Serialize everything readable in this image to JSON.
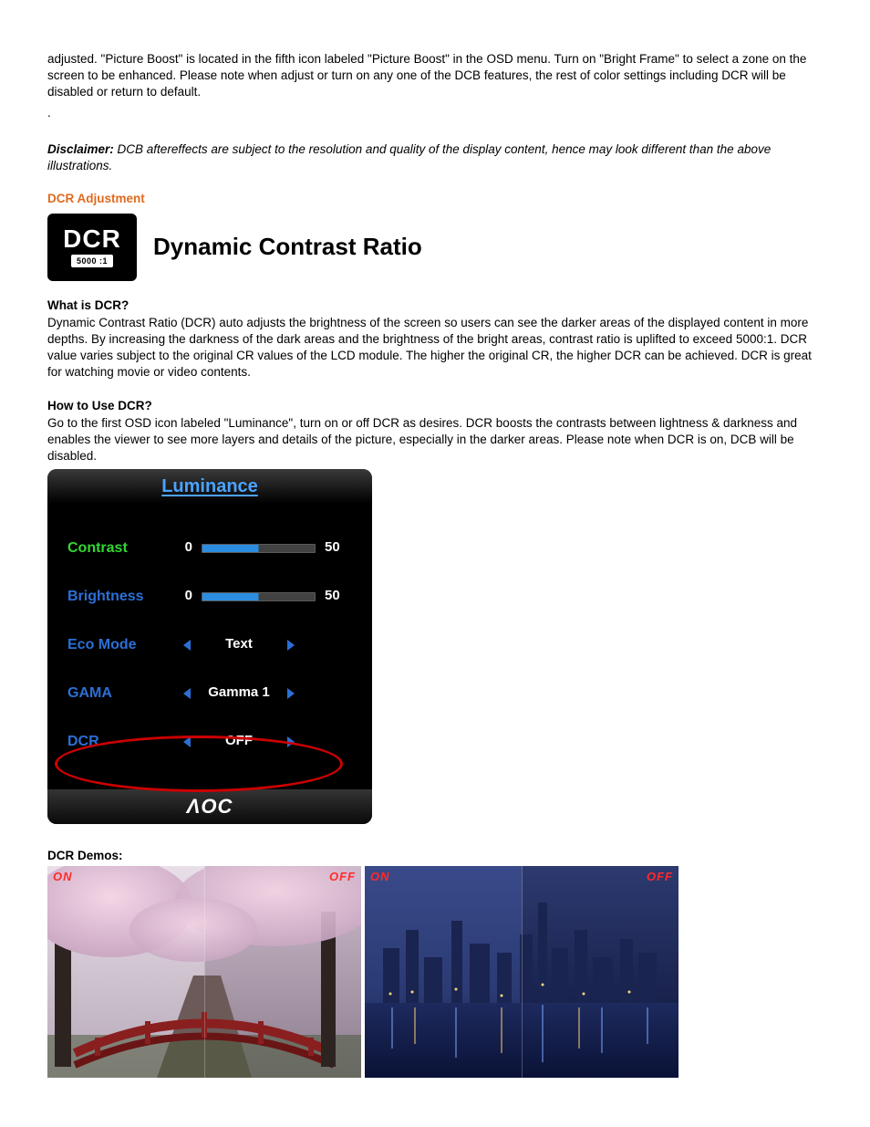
{
  "intro": {
    "paragraph": "adjusted. \"Picture Boost\" is located in the fifth icon labeled \"Picture Boost\" in the OSD menu. Turn on \"Bright Frame\" to select a zone on the screen to be enhanced. Please note when adjust or turn on any one of the DCB features, the rest of color settings including DCR will be disabled or return to default.",
    "dot": "."
  },
  "disclaimer": {
    "label": "Disclaimer:",
    "text": " DCB aftereffects are subject to the resolution and quality of the display content, hence may look different than the above illustrations."
  },
  "dcr": {
    "heading": "DCR Adjustment",
    "icon_text": "DCR",
    "icon_ratio": "5000 :1",
    "title": "Dynamic Contrast Ratio",
    "what_heading": "What is DCR?",
    "what_text": "Dynamic Contrast Ratio (DCR) auto adjusts the brightness of the screen so users can see the darker areas of the displayed content in more depths. By increasing the darkness of the dark areas and the brightness of the bright areas, contrast ratio is uplifted to exceed 5000:1. DCR value varies subject to the original CR values of the LCD module. The higher the original CR, the higher DCR can be achieved. DCR is great for watching movie or video contents.",
    "how_heading": "How to Use DCR?",
    "how_text": "Go to the first OSD icon labeled \"Luminance\", turn on or off DCR as desires. DCR boosts the contrasts between lightness & darkness and enables the viewer to see more layers and details of the picture, especially in the darker areas. Please note when DCR is on, DCB will be disabled."
  },
  "osd": {
    "title": "Luminance",
    "rows": {
      "contrast": {
        "label": "Contrast",
        "min": "0",
        "max": "50"
      },
      "brightness": {
        "label": "Brightness",
        "min": "0",
        "max": "50"
      },
      "eco": {
        "label": "Eco Mode",
        "value": "Text"
      },
      "gama": {
        "label": "GAMA",
        "value": "Gamma 1"
      },
      "dcr": {
        "label": "DCR",
        "value": "OFF"
      }
    },
    "brand": "ΛOC"
  },
  "demos": {
    "heading": "DCR Demos:",
    "on_label": "ON",
    "off_label": "OFF"
  }
}
